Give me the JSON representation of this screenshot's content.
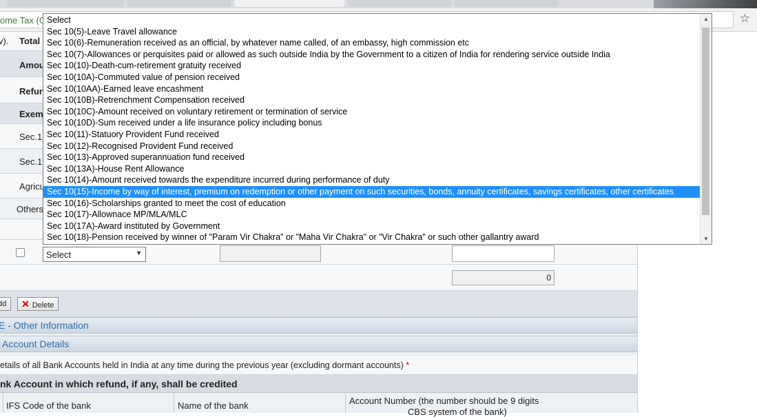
{
  "browser": {
    "address_text": "ome Tax (G"
  },
  "form": {
    "left_labels": {
      "header_frag": "v).",
      "total": "Total",
      "amount": "Amou",
      "refund": "Refun",
      "exempt": "Exem",
      "sec1": "Sec.1",
      "sec2": "Sec.1",
      "agri": "Agricu",
      "others": "Others"
    },
    "select_row": {
      "select_value": "Select",
      "select_arrow": "▼"
    },
    "total_row": {
      "total_value": "0"
    },
    "buttons": {
      "add_label": "dd",
      "delete_label": "Delete",
      "delete_icon": "✕"
    },
    "sections": {
      "other_info": "E - Other Information",
      "account_details": "Account Details"
    },
    "bank": {
      "note": "etails of all Bank Accounts held in India at any time during the previous year (excluding dormant accounts)",
      "required_mark": "*",
      "refund_header": "nk Account in which refund, if any, shall be credited",
      "col_ifs": "IFS Code of the bank",
      "col_name": "Name of the bank",
      "col_account_line1": "Account Number (the number should be 9 digits",
      "col_account_line2": "CBS system of the bank)"
    }
  },
  "dropdown": {
    "selected_index": 15,
    "options": [
      "Select",
      "Sec 10(5)-Leave Travel allowance",
      "Sec 10(6)-Remuneration received as an official, by whatever name called, of an embassy, high commission etc",
      "Sec 10(7)-Allowances or perquisites paid or allowed as such outside India by the Government to a citizen of India for rendering service outside India",
      "Sec 10(10)-Death-cum-retirement gratuity received",
      "Sec 10(10A)-Commuted value of pension received",
      "Sec 10(10AA)-Earned leave encashment",
      "Sec 10(10B)-Retrenchment Compensation received",
      "Sec 10(10C)-Amount received on voluntary retirement or termination of service",
      "Sec 10(10D)-Sum received under a life insurance policy including bonus",
      "Sec 10(11)-Statuory Provident Fund received",
      "Sec 10(12)-Recognised Provident Fund received",
      "Sec 10(13)-Approved superannuation fund received",
      "Sec 10(13A)-House Rent Allowance",
      "Sec 10(14)-Amount received towards the expenditure incurred during performance of duty",
      "Sec 10(15)-Income by way of interest, premium on redemption or other payment on such securities, bonds, annuity certificates, savings certificates, other certificates",
      "Sec 10(16)-Scholarships granted to meet the cost of education",
      "Sec 10(17)-Allownace MP/MLA/MLC",
      "Sec 10(17A)-Award instituted by Government",
      "Sec 10(18)-Pension received by winner of \"Param Vir Chakra\" or \"Maha Vir Chakra\" or \"Vir Chakra\" or such other gallantry award"
    ]
  },
  "icons": {
    "star": "☆",
    "scroll_up": "▲",
    "scroll_down": "▼"
  },
  "colors": {
    "selection": "#1e90ff",
    "section_text": "#2f6ea5",
    "delete_icon": "#d40000"
  }
}
